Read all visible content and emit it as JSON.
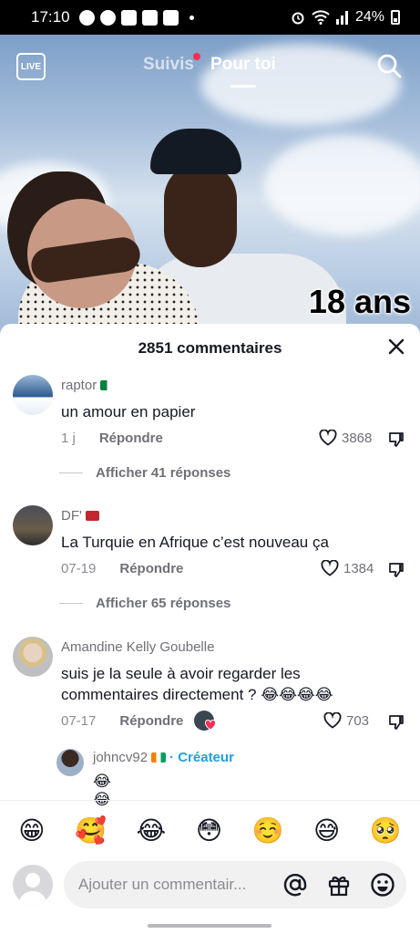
{
  "status_bar": {
    "time": "17:10",
    "battery": "24%"
  },
  "top_nav": {
    "live_label": "LIVE",
    "tabs": [
      {
        "label": "Suivis"
      },
      {
        "label": "Pour toi"
      }
    ]
  },
  "video": {
    "caption": "18 ans"
  },
  "comments_sheet": {
    "title": "2851 commentaires",
    "comments": [
      {
        "user": "raptor",
        "text": "un amour en papier",
        "date": "1 j",
        "reply_label": "Répondre",
        "likes": "3868",
        "view_replies": "Afficher 41 réponses"
      },
      {
        "user": "DF'",
        "text": "La Turquie en Afrique c’est nouveau ça",
        "date": "07-19",
        "reply_label": "Répondre",
        "likes": "1384",
        "view_replies": "Afficher 65 réponses"
      },
      {
        "user": "Amandine Kelly Goubelle",
        "text": "suis je la seule à avoir regarder les commentaires directement ? 😂😂😂😂",
        "date": "07-17",
        "reply_label": "Répondre",
        "likes": "703",
        "reply": {
          "user": "johncv92",
          "tag": "· Créateur",
          "text": "😂😂"
        }
      }
    ]
  },
  "emoji_bar": [
    "😁",
    "🥰",
    "😂",
    "😳",
    "☺️",
    "😅",
    "🥺"
  ],
  "comment_input": {
    "placeholder": "Ajouter un commentair..."
  },
  "colors": {
    "accent": "#fe2c55",
    "creator": "#1fa0e0",
    "text": "#161823",
    "muted": "#8a8b91"
  }
}
